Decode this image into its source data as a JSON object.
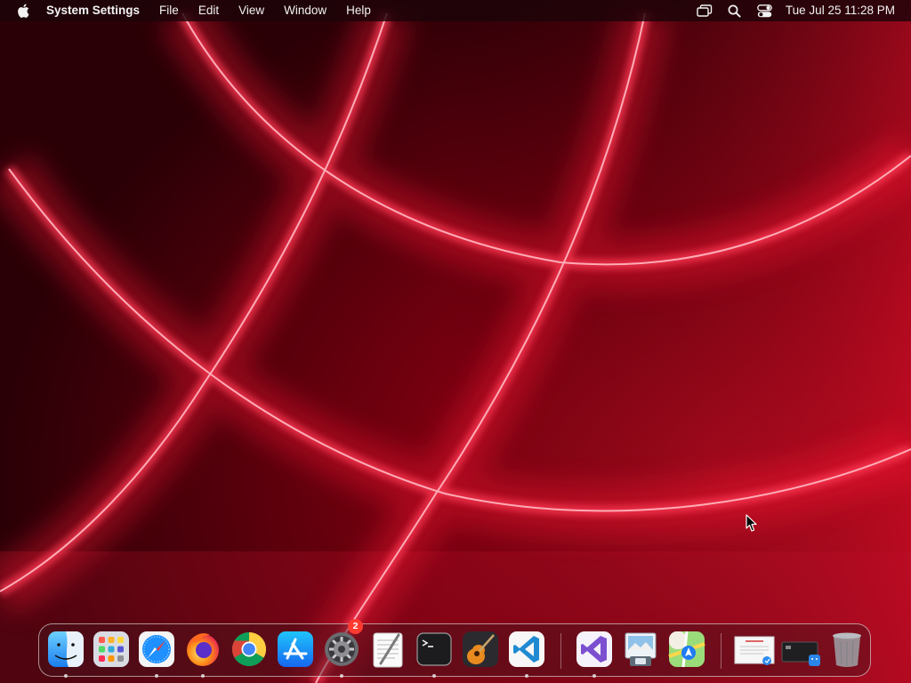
{
  "menubar": {
    "app_name": "System Settings",
    "menus": [
      "File",
      "Edit",
      "View",
      "Window",
      "Help"
    ],
    "status_icons": [
      "screen-mirroring-icon",
      "search-icon",
      "control-center-icon"
    ],
    "clock": "Tue Jul 25  11:28 PM"
  },
  "dock": {
    "apps": [
      {
        "name": "Finder",
        "icon": "finder-icon",
        "running": true
      },
      {
        "name": "Launchpad",
        "icon": "launchpad-icon",
        "running": false
      },
      {
        "name": "Safari",
        "icon": "safari-icon",
        "running": true
      },
      {
        "name": "Firefox",
        "icon": "firefox-icon",
        "running": true
      },
      {
        "name": "Google Chrome",
        "icon": "chrome-icon",
        "running": false
      },
      {
        "name": "App Store",
        "icon": "app-store-icon",
        "running": false
      },
      {
        "name": "System Settings",
        "icon": "system-settings-icon",
        "running": true,
        "badge": "2"
      },
      {
        "name": "TextEdit",
        "icon": "textedit-icon",
        "running": false
      },
      {
        "name": "Terminal",
        "icon": "terminal-icon",
        "running": true
      },
      {
        "name": "GarageBand",
        "icon": "garageband-icon",
        "running": false
      },
      {
        "name": "Visual Studio Code",
        "icon": "vscode-icon",
        "running": true
      },
      {
        "name": "Visual Studio",
        "icon": "visual-studio-icon",
        "running": true
      },
      {
        "name": "Preview",
        "icon": "preview-icon",
        "running": false
      },
      {
        "name": "Maps",
        "icon": "maps-icon",
        "running": false
      },
      {
        "name": "Downloads document",
        "icon": "document-stack-icon",
        "running": false
      },
      {
        "name": "Applications folder",
        "icon": "apps-stack-icon",
        "running": false
      },
      {
        "name": "Trash",
        "icon": "trash-icon",
        "running": false
      }
    ]
  },
  "colors": {
    "wallpaper_dark": "#3a0008",
    "wallpaper_bright": "#ff2a45",
    "badge": "#ff3b30",
    "menubar_text": "#f2f2f2"
  }
}
